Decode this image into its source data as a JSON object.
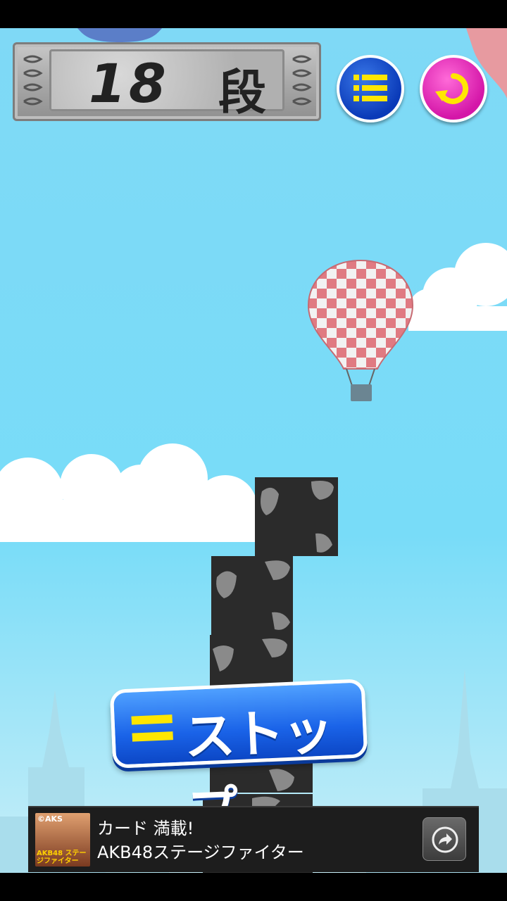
{
  "game": {
    "score_value": "18",
    "score_unit": "段",
    "menu_icon": "list-icon",
    "retry_icon": "retry-icon",
    "stop_label": "ストップ",
    "tower_blocks": 6,
    "colors": {
      "sky": "#7fd9f6",
      "menu_button": "#0a3ab8",
      "retry_button": "#d416a8",
      "stop_button": "#1a63e8",
      "stop_icon": "#ffe600",
      "block": "#2b2b2b"
    }
  },
  "ad": {
    "thumb_brand": "©AKS",
    "thumb_caption": "AKB48 ステージファイター",
    "line1": "カード 満載!",
    "line2": "AKB48ステージファイター",
    "action_icon": "share-arrow-icon"
  }
}
